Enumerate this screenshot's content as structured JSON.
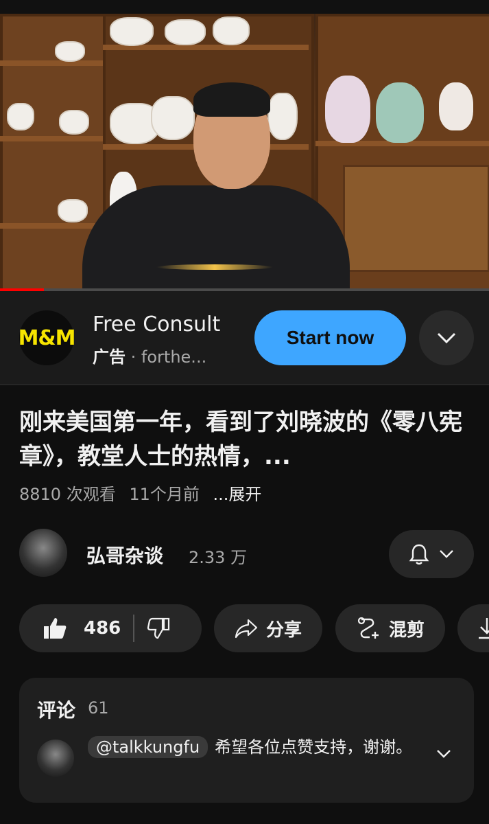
{
  "ad": {
    "logo_text": "M&M",
    "title": "Free Consult",
    "ad_label": "广告",
    "separator": "·",
    "domain": "forthe...",
    "cta_label": "Start now"
  },
  "video": {
    "title": "刚来美国第一年，看到了刘晓波的《零八宪章》，教堂人士的热情，...",
    "views": "8810 次观看",
    "age": "11个月前",
    "more": "...展开",
    "progress": 0.09
  },
  "channel": {
    "name": "弘哥杂谈",
    "subscribers": "2.33 万"
  },
  "actions": {
    "likes": "486",
    "share": "分享",
    "remix": "混剪"
  },
  "comments": {
    "title": "评论",
    "count": "61",
    "top_handle": "@talkkungfu",
    "top_text": "希望各位点赞支持，谢谢。"
  },
  "colors": {
    "accent_blue": "#3ea6ff",
    "progress_red": "#ff0000",
    "background": "#0f0f0f"
  }
}
